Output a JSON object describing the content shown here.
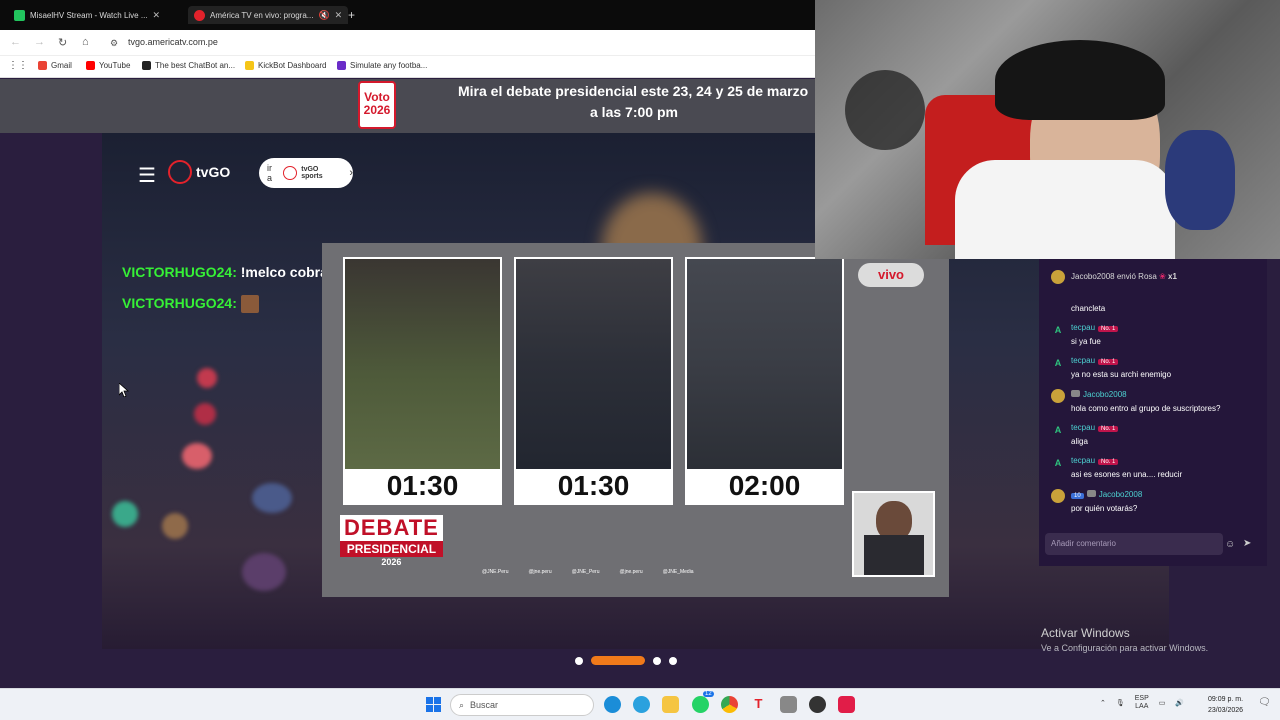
{
  "browser": {
    "tabs": [
      {
        "title": "MisaelHV Stream - Watch Live ...",
        "active": false,
        "fav_color": "#22c55e"
      },
      {
        "title": "América TV en vivo: progra...",
        "active": true,
        "fav_color": "#e3222b"
      }
    ],
    "new_tab": "+",
    "url": "tvgo.americatv.com.pe",
    "bookmarks": [
      {
        "label": "Gmail",
        "color": "#ea4335"
      },
      {
        "label": "YouTube",
        "color": "#ff0000"
      },
      {
        "label": "The best ChatBot an...",
        "color": "#222222"
      },
      {
        "label": "KickBot Dashboard",
        "color": "#f5c518"
      },
      {
        "label": "Simulate any footba...",
        "color": "#6a2cc8"
      }
    ]
  },
  "banner": {
    "badge_line1": "Voto",
    "badge_line2": "2026",
    "line1": "Mira el debate presidencial este 23, 24 y 25 de marzo",
    "line2": "a las 7:00 pm"
  },
  "site": {
    "logo": "tvGO",
    "ira_label": "ir a",
    "ira_brand": "tvGO sports"
  },
  "overlay_chat": [
    {
      "user": "VICTORHUGO24:",
      "msg": "!melco cobra tu corner"
    },
    {
      "user": "VICTORHUGO24:",
      "msg": ""
    }
  ],
  "debate": {
    "candidates": [
      {
        "timer": "01:30",
        "bg": "#4e5a3a"
      },
      {
        "timer": "01:30",
        "bg": "#2c2f38"
      },
      {
        "timer": "02:00",
        "bg": "#3a3d45"
      }
    ],
    "vivo_label": "vivo",
    "logo_top": "DEBATE",
    "logo_mid": "PRESIDENCIAL",
    "logo_year": "2026",
    "socials": [
      "@JNE.Peru",
      "@jne.peru",
      "@JNE_Peru",
      "@jne.peru",
      "@JNE_Media"
    ]
  },
  "live_chat": {
    "gift": {
      "user": "Jacobo2008",
      "text": "envió Rosa",
      "count": "x1"
    },
    "messages": [
      {
        "user": "",
        "badge": "",
        "text": "chancleta"
      },
      {
        "user": "tecpau",
        "badge": "No. 1",
        "text": "si ya fue"
      },
      {
        "user": "tecpau",
        "badge": "No. 1",
        "text": "ya no esta su archi enemigo"
      },
      {
        "user": "Jacobo2008",
        "badge": "",
        "text": "hola como entro al grupo de suscriptores?"
      },
      {
        "user": "tecpau",
        "badge": "No. 1",
        "text": "aliga"
      },
      {
        "user": "tecpau",
        "badge": "No. 1",
        "text": "asi es esones en una.... reducir"
      },
      {
        "user": "Jacobo2008",
        "badge": "10",
        "text": "por quién votarás?"
      }
    ],
    "comment_placeholder": "Añadir comentario"
  },
  "windows_activation": {
    "title": "Activar Windows",
    "subtitle": "Ve a Configuración para activar Windows."
  },
  "taskbar": {
    "search": "Buscar",
    "whatsapp_badge": "12",
    "lang1": "ESP",
    "lang2": "LAA",
    "time": "09:09 p. m.",
    "date": "23/03/2026"
  }
}
